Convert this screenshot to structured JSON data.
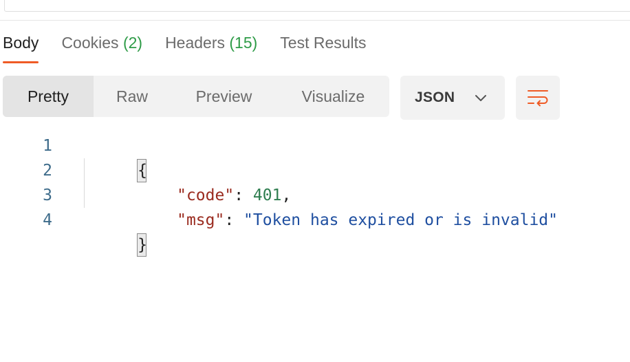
{
  "response_tabs": [
    {
      "label": "Body",
      "count": "",
      "active": true
    },
    {
      "label": "Cookies",
      "count": "(2)",
      "active": false
    },
    {
      "label": "Headers",
      "count": "(15)",
      "active": false
    },
    {
      "label": "Test Results",
      "count": "",
      "active": false
    }
  ],
  "view_modes": {
    "pretty": "Pretty",
    "raw": "Raw",
    "preview": "Preview",
    "visualize": "Visualize",
    "selected": "Pretty"
  },
  "format_select": {
    "value": "JSON",
    "icon": "chevron-down-icon"
  },
  "wrap_button": {
    "icon": "wrap-lines-icon"
  },
  "editor": {
    "line_numbers": [
      "1",
      "2",
      "3",
      "4"
    ],
    "open_brace": "{",
    "close_brace": "}",
    "lines": [
      {
        "key": "\"code\"",
        "sep": ": ",
        "value": "401",
        "trail": ","
      },
      {
        "key": "\"msg\"",
        "sep": ": ",
        "value": "\"Token has expired or is invalid\"",
        "trail": ""
      }
    ]
  },
  "colors": {
    "accent": "#ef5b25",
    "count": "#2e9b47",
    "json_key": "#9a2b1f",
    "json_number": "#2e7d4f",
    "json_string": "#1f4fa0",
    "line_number": "#3d6b8a"
  }
}
